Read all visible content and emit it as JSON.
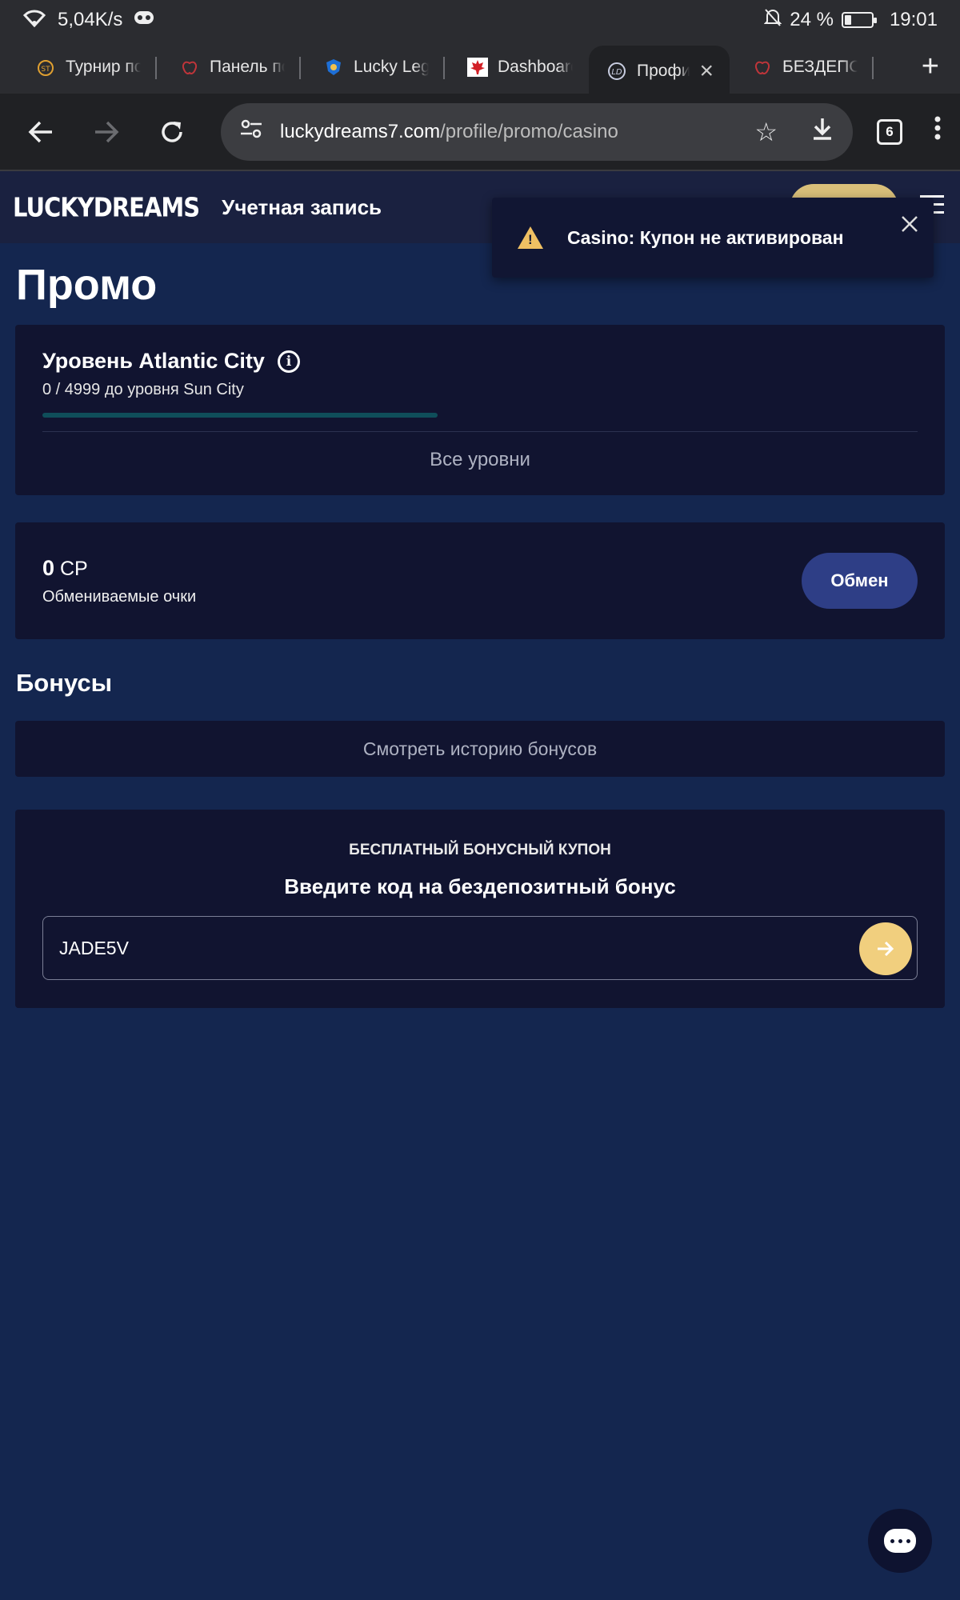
{
  "status_bar": {
    "speed": "5,04K/s",
    "battery": "24 %",
    "battery_level": 0.24,
    "time": "19:01"
  },
  "tabs": [
    {
      "label": "Турнир по",
      "icon": "tournament-icon"
    },
    {
      "label": "Панель по",
      "icon": "apple-logo-icon"
    },
    {
      "label": "Lucky Lege",
      "icon": "shield-logo-icon"
    },
    {
      "label": "Dashboard",
      "icon": "maple-leaf-icon"
    },
    {
      "label": "Профиль",
      "icon": "ld-logo-icon",
      "active": true
    },
    {
      "label": "БЕЗДЕПОЗ",
      "icon": "apple-logo-icon"
    }
  ],
  "toolbar": {
    "url_host": "luckydreams7.com",
    "url_path": "/profile/promo/casino",
    "tab_count": "6"
  },
  "site_header": {
    "logo": "LUCKYDREAMS",
    "account_title": "Учетная запись"
  },
  "toast": {
    "message": "Casino: Купон не активирован"
  },
  "page": {
    "title": "Промо"
  },
  "level": {
    "title": "Уровень Atlantic City",
    "subtitle": "0 / 4999 до уровня Sun City",
    "progress": 0.0,
    "all_levels": "Все уровни"
  },
  "points": {
    "value": "0",
    "unit": "CP",
    "label": "Обмениваемые очки",
    "exchange_label": "Обмен"
  },
  "bonuses": {
    "title": "Бонусы",
    "history_link": "Смотреть историю бонусов"
  },
  "coupon": {
    "subtitle": "БЕСПЛАТНЫЙ БОНУСНЫЙ КУПОН",
    "title": "Введите код на бездепозитный бонус",
    "value": "JADE5V"
  },
  "colors": {
    "page_bg": "#14264f",
    "card_bg": "#111430",
    "accent_gold": "#f1cf7e",
    "button_blue": "#2e3e86",
    "warning": "#f0c063"
  }
}
